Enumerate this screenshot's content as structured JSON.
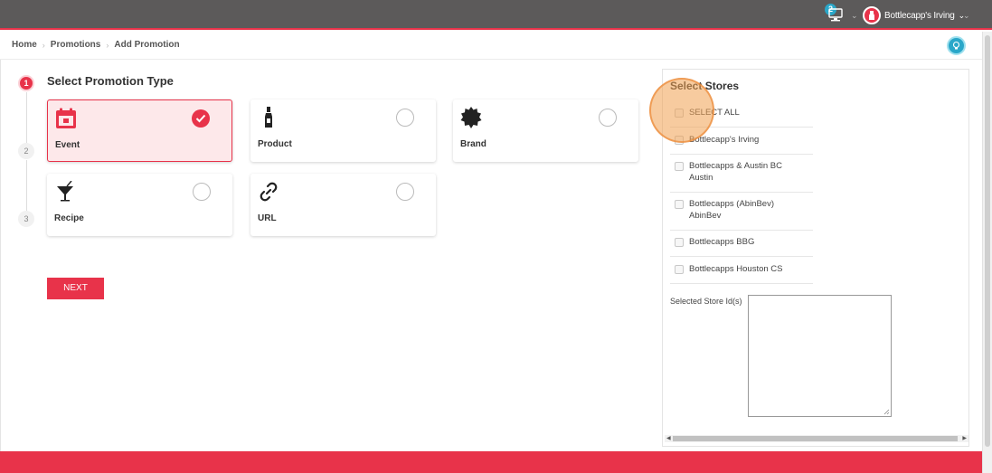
{
  "topbar": {
    "notification_count": "2",
    "username": "Bottlecapp's Irving"
  },
  "breadcrumb": [
    "Home",
    "Promotions",
    "Add Promotion"
  ],
  "steps": [
    "1",
    "2",
    "3"
  ],
  "section_title": "Select Promotion Type",
  "promotion_types": [
    {
      "label": "Event",
      "icon": "calendar-icon",
      "selected": true
    },
    {
      "label": "Product",
      "icon": "bottle-icon",
      "selected": false
    },
    {
      "label": "Brand",
      "icon": "badge-seal-icon",
      "selected": false
    },
    {
      "label": "Recipe",
      "icon": "cocktail-glass-icon",
      "selected": false
    },
    {
      "label": "URL",
      "icon": "link-icon",
      "selected": false
    }
  ],
  "next_label": "NEXT",
  "stores": {
    "title": "Select Stores",
    "items": [
      {
        "label": "SELECT ALL"
      },
      {
        "label": "Bottlecapp's Irving"
      },
      {
        "label": "Bottlecapps & Austin BC Austin"
      },
      {
        "label": "Bottlecapps (AbinBev) AbinBev"
      },
      {
        "label": "Bottlecapps BBG"
      },
      {
        "label": "Bottlecapps Houston CS"
      }
    ],
    "selected_ids_label": "Selected Store Id(s)",
    "selected_ids_value": ""
  },
  "colors": {
    "accent": "#e8334a",
    "topbar": "#5c5a5a",
    "help": "#2aa7c9"
  }
}
